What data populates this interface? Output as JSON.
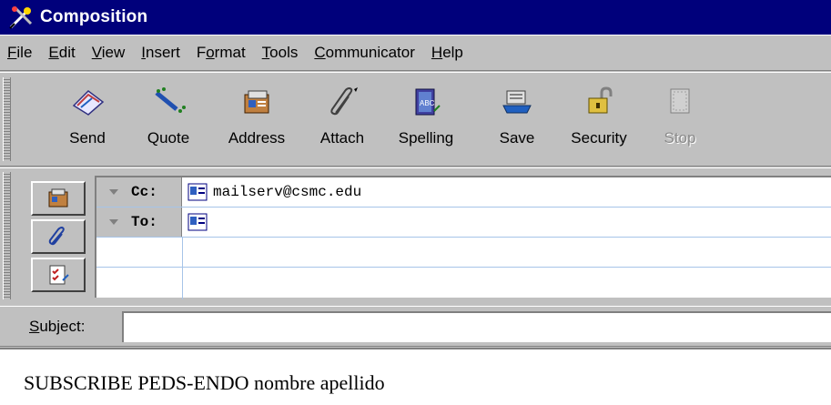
{
  "window": {
    "title": "Composition",
    "icon": "composition-icon"
  },
  "menu": [
    {
      "pre": "",
      "key": "F",
      "post": "ile"
    },
    {
      "pre": "",
      "key": "E",
      "post": "dit"
    },
    {
      "pre": "",
      "key": "V",
      "post": "iew"
    },
    {
      "pre": "",
      "key": "I",
      "post": "nsert"
    },
    {
      "pre": "F",
      "key": "o",
      "post": "rmat"
    },
    {
      "pre": "",
      "key": "T",
      "post": "ools"
    },
    {
      "pre": "",
      "key": "C",
      "post": "ommunicator"
    },
    {
      "pre": "",
      "key": "H",
      "post": "elp"
    }
  ],
  "toolbar": {
    "send": "Send",
    "quote": "Quote",
    "address": "Address",
    "attach": "Attach",
    "spelling": "Spelling",
    "save": "Save",
    "security": "Security",
    "stop": "Stop"
  },
  "addressing": {
    "rows": [
      {
        "field": "Cc:",
        "value": "mailserv@csmc.edu"
      },
      {
        "field": "To:",
        "value": ""
      }
    ]
  },
  "subject": {
    "label_key": "S",
    "label_rest": "ubject:",
    "value": ""
  },
  "message": {
    "body": "SUBSCRIBE PEDS-ENDO nombre apellido"
  },
  "colors": {
    "titlebar": "#00007b",
    "chrome": "#c0c0c0",
    "row_line": "#a6c4e8"
  }
}
